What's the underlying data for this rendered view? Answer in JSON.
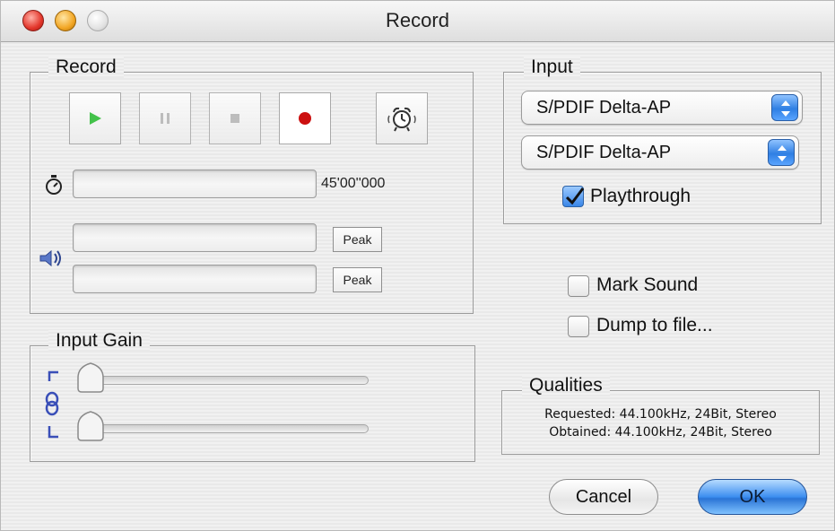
{
  "window": {
    "title": "Record"
  },
  "record_group": {
    "label": "Record",
    "transport": {
      "play": "play-icon",
      "pause": "pause-icon",
      "stop": "stop-icon",
      "record": "record-icon",
      "alarm": "alarm-clock-icon"
    },
    "timer_icon": "stopwatch-icon",
    "time_value": "45'00''000",
    "speaker_icon": "speaker-icon",
    "peak_left_label": "Peak",
    "peak_right_label": "Peak"
  },
  "input_gain_group": {
    "label": "Input Gain",
    "link_icon": "link-channels-icon",
    "left_level": 0,
    "right_level": 0
  },
  "input_group": {
    "label": "Input",
    "source_selected": "S/PDIF Delta-AP",
    "format_selected": "S/PDIF Delta-AP",
    "playthrough_label": "Playthrough",
    "playthrough_checked": true
  },
  "options": {
    "mark_sound_label": "Mark Sound",
    "mark_sound_checked": false,
    "dump_label": "Dump to file...",
    "dump_checked": false
  },
  "qualities_group": {
    "label": "Qualities",
    "requested": "Requested: 44.100kHz, 24Bit, Stereo",
    "obtained": "Obtained: 44.100kHz, 24Bit, Stereo"
  },
  "buttons": {
    "cancel_label": "Cancel",
    "ok_label": "OK"
  },
  "colors": {
    "accent_blue": "#3a86e8",
    "record_red": "#cc1010",
    "play_green": "#43c24a"
  }
}
